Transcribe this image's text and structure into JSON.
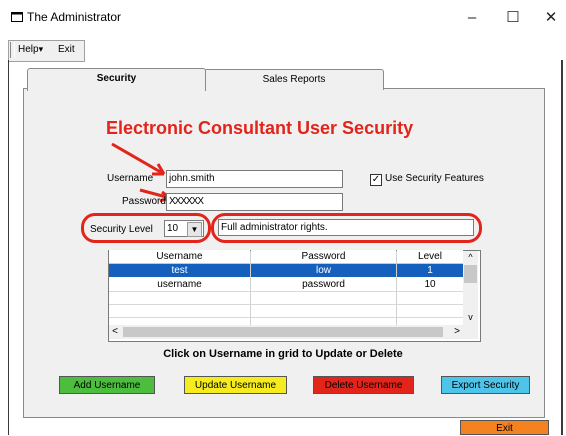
{
  "window": {
    "title": "The Administrator",
    "controls": {
      "minimize": "–",
      "maximize": "☐",
      "close": "✕"
    }
  },
  "menu": {
    "help": "Help",
    "help_arrow": "▾",
    "exit": "Exit"
  },
  "tabs": [
    {
      "label": "Security",
      "active": true
    },
    {
      "label": "Sales Reports",
      "active": false
    }
  ],
  "heading": "Electronic Consultant User Security",
  "form": {
    "username_label": "Username",
    "username_value": "john.smith",
    "password_label": "Password",
    "password_value": "XXXXXX",
    "use_security_checked": true,
    "use_security_label": "Use Security Features",
    "security_level_label": "Security Level",
    "security_level_value": "10",
    "security_level_description": "Full administrator rights."
  },
  "grid": {
    "columns": [
      "Username",
      "Password",
      "Level"
    ],
    "rows": [
      {
        "username": "test",
        "password": "low",
        "level": "1",
        "selected": true
      },
      {
        "username": "username",
        "password": "password",
        "level": "10",
        "selected": false
      }
    ]
  },
  "note": "Click on Username in grid to Update or Delete",
  "buttons": {
    "add": {
      "label": "Add Username",
      "color": "#4cbd3e"
    },
    "update": {
      "label": "Update Username",
      "color": "#f6ec1d"
    },
    "delete": {
      "label": "Delete Username",
      "color": "#e3241b"
    },
    "export": {
      "label": "Export Security",
      "color": "#4ec5e8"
    },
    "exit": {
      "label": "Exit",
      "color": "#f58220"
    }
  },
  "annotation_color": "#e3241b"
}
